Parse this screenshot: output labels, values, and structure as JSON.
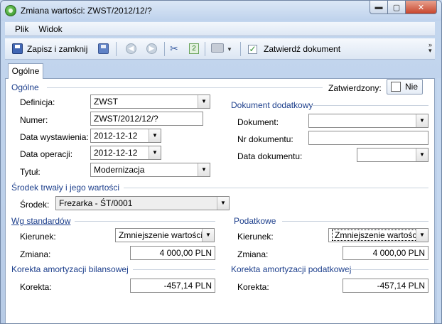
{
  "window": {
    "title": "Zmiana wartości: ZWST/2012/12/?"
  },
  "menu": {
    "items": [
      "Plik",
      "Widok"
    ]
  },
  "toolbar": {
    "save_close_label": "Zapisz i zamknij",
    "approve_label": "Zatwierdź dokument"
  },
  "tabs": [
    {
      "label": "Ogólne"
    }
  ],
  "general": {
    "section_title": "Ogólne",
    "approved_label": "Zatwierdzony:",
    "approved_value": "Nie",
    "definicja_label": "Definicja:",
    "definicja_value": "ZWST",
    "numer_label": "Numer:",
    "numer_value": "ZWST/2012/12/?",
    "data_wyst_label": "Data wystawienia:",
    "data_wyst_value": "2012-12-12",
    "data_oper_label": "Data operacji:",
    "data_oper_value": "2012-12-12",
    "tytul_label": "Tytuł:",
    "tytul_value": "Modernizacja"
  },
  "additional_doc": {
    "section_title": "Dokument dodatkowy",
    "dokument_label": "Dokument:",
    "dokument_value": "",
    "nr_label": "Nr dokumentu:",
    "nr_value": "",
    "data_label": "Data dokumentu:",
    "data_value": ""
  },
  "asset": {
    "section_title": "Środek trwały i jego wartości",
    "srodek_label": "Środek:",
    "srodek_value": "Frezarka - ŚT/0001"
  },
  "standards": {
    "section_title": "Wg standardów",
    "kierunek_label": "Kierunek:",
    "kierunek_value": "Zmniejszenie wartości",
    "zmiana_label": "Zmiana:",
    "zmiana_value": "4 000,00 PLN"
  },
  "tax": {
    "section_title": "Podatkowe",
    "kierunek_label": "Kierunek:",
    "kierunek_value": "Zmniejszenie wartości",
    "zmiana_label": "Zmiana:",
    "zmiana_value": "4 000,00 PLN"
  },
  "balance_correction": {
    "section_title": "Korekta amortyzacji bilansowej",
    "korekta_label": "Korekta:",
    "korekta_value": "-457,14 PLN"
  },
  "tax_correction": {
    "section_title": "Korekta amortyzacji podatkowej",
    "korekta_label": "Korekta:",
    "korekta_value": "-457,14 PLN"
  }
}
